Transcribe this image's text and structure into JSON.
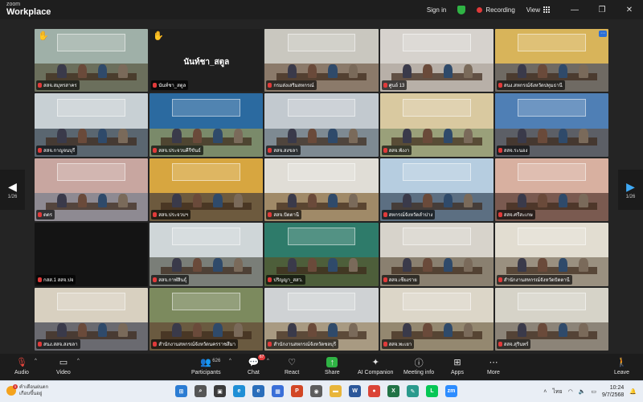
{
  "window": {
    "brand_small": "zoom",
    "brand_big": "Workplace",
    "sign_in": "Sign in",
    "recording": "Recording",
    "view": "View",
    "minimize": "—",
    "maximize": "❐",
    "close": "✕"
  },
  "pager": {
    "left_label": "1/26",
    "right_label": "1/26",
    "left_arrow": "◀",
    "right_arrow": "▶"
  },
  "tiles": [
    {
      "name": "สสจ.สมุทรสาคร",
      "hand": true
    },
    {
      "name": "นันท์ชา_สตูล",
      "center": "นันท์ชา_สตูล",
      "hand": true
    },
    {
      "name": "กรมส่งเสริมสหกรณ์",
      "active": true
    },
    {
      "name": "ศูนย์ 13"
    },
    {
      "name": "สนง.สหกรณ์จังหวัดปทุมธานี",
      "menu": true
    },
    {
      "name": "สสจ.กาญจนบุรี"
    },
    {
      "name": "สสจ.ประจวบคีรีขันธ์"
    },
    {
      "name": "สสจ.สงขลา"
    },
    {
      "name": "สสจ.พังงา"
    },
    {
      "name": "สสจ.ระนอง"
    },
    {
      "name": "ตตร"
    },
    {
      "name": "สสจ.ประจวบฯ"
    },
    {
      "name": "สสจ.ปัตตานี"
    },
    {
      "name": "สหกรณ์จังหวัดลำปาง"
    },
    {
      "name": "สสจ.ศรีสะเกษ"
    },
    {
      "name": "กสส.1 สสจ.ปจ"
    },
    {
      "name": "สสจ.กาฬสินธุ์"
    },
    {
      "name": "ปริญญา_สสว."
    },
    {
      "name": "สสจ.เชียงราย"
    },
    {
      "name": "สำนักงานสหกรณ์จังหวัดปัตตานี"
    },
    {
      "name": "สนง.สสจ.สงขลา"
    },
    {
      "name": "สำนักงานสหกรณ์จังหวัดนครราชสีมา"
    },
    {
      "name": "สำนักงานสหกรณ์จังหวัดชลบุรี"
    },
    {
      "name": "สสจ.พะเยา"
    },
    {
      "name": "สสจ.สุรินทร์"
    }
  ],
  "toolbar": {
    "audio": "Audio",
    "video": "Video",
    "participants": "Participants",
    "participants_count": "626",
    "chat": "Chat",
    "chat_badge": "67",
    "react": "React",
    "share": "Share",
    "ai": "AI Companion",
    "meeting_info": "Meeting info",
    "apps": "Apps",
    "more": "More",
    "leave": "Leave"
  },
  "taskbar": {
    "weather_line1": "คำเตือนฝนตก",
    "weather_line2": "เกือบขึ้นอยู่",
    "lang": "ไทย",
    "time": "10:24",
    "date": "9/7/2568",
    "apps": [
      {
        "name": "start",
        "glyph": "⊞",
        "color": "#2b7cd3"
      },
      {
        "name": "search",
        "glyph": "⌕",
        "color": "#555555"
      },
      {
        "name": "task-view",
        "glyph": "▣",
        "color": "#3b3b3b"
      },
      {
        "name": "edge",
        "glyph": "e",
        "color": "#1f8fd6"
      },
      {
        "name": "edge-dev",
        "glyph": "e",
        "color": "#2a6ebb"
      },
      {
        "name": "store",
        "glyph": "▦",
        "color": "#3a6fd8"
      },
      {
        "name": "powerpoint",
        "glyph": "P",
        "color": "#d24726"
      },
      {
        "name": "camera",
        "glyph": "◉",
        "color": "#5d5d5d"
      },
      {
        "name": "files",
        "glyph": "▬",
        "color": "#e8b53a"
      },
      {
        "name": "word",
        "glyph": "W",
        "color": "#2b579a"
      },
      {
        "name": "chrome",
        "glyph": "●",
        "color": "#db4437"
      },
      {
        "name": "excel",
        "glyph": "X",
        "color": "#217346"
      },
      {
        "name": "photos",
        "glyph": "✎",
        "color": "#2a9a8d"
      },
      {
        "name": "line",
        "glyph": "L",
        "color": "#06c755"
      },
      {
        "name": "zoom",
        "glyph": "zm",
        "color": "#2d8cff"
      }
    ]
  },
  "colors": {
    "accent": "#2d8cff",
    "recording": "#e03a3a",
    "active_speaker": "#33c66b",
    "leave": "#e8453c"
  }
}
